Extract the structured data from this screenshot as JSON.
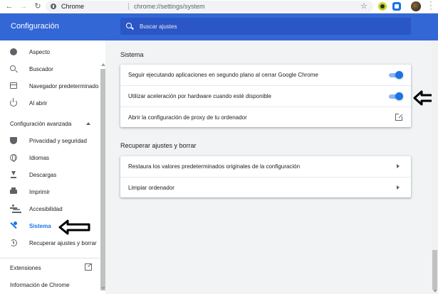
{
  "browser": {
    "omnibox": {
      "origin": "Chrome",
      "url": "chrome://settings/system"
    },
    "icons": [
      "back-icon",
      "forward-icon",
      "reload-icon",
      "site-info-icon",
      "star-icon",
      "extension-icon",
      "avatar",
      "menu-icon"
    ]
  },
  "header": {
    "title": "Configuración",
    "search_placeholder": "Buscar ajustes"
  },
  "sidebar": {
    "items": [
      {
        "label": "Aspecto",
        "icon": "palette-icon"
      },
      {
        "label": "Buscador",
        "icon": "search-icon"
      },
      {
        "label": "Navegador predeterminado",
        "icon": "browser-icon"
      },
      {
        "label": "Al abrir",
        "icon": "power-icon"
      }
    ],
    "advanced_label": "Configuración avanzada",
    "advanced_items": [
      {
        "label": "Privacidad y seguridad",
        "icon": "shield-icon"
      },
      {
        "label": "Idiomas",
        "icon": "globe-icon"
      },
      {
        "label": "Descargas",
        "icon": "download-icon"
      },
      {
        "label": "Imprimir",
        "icon": "print-icon"
      },
      {
        "label": "Accesibilidad",
        "icon": "accessibility-icon"
      },
      {
        "label": "Sistema",
        "icon": "wrench-icon",
        "active": true
      },
      {
        "label": "Recuperar ajustes y borrar",
        "icon": "restore-icon"
      }
    ],
    "extensions_label": "Extensiones",
    "about_label": "Información de Chrome"
  },
  "main": {
    "system": {
      "title": "Sistema",
      "rows": [
        {
          "label": "Seguir ejecutando aplicaciones en segundo plano al cerrar Google Chrome",
          "control": "toggle",
          "on": true
        },
        {
          "label": "Utilizar aceleración por hardware cuando esté disponible",
          "control": "toggle",
          "on": true
        },
        {
          "label": "Abrir la configuración de proxy de tu ordenador",
          "control": "open-link-icon"
        }
      ]
    },
    "reset": {
      "title": "Recuperar ajustes y borrar",
      "rows": [
        {
          "label": "Restaura los valores predeterminados originales de la configuración",
          "control": "chevron-right-icon"
        },
        {
          "label": "Limpiar ordenador",
          "control": "chevron-right-icon"
        }
      ]
    }
  },
  "colors": {
    "header_blue": "#3367d6",
    "search_blue": "#2a56c6",
    "accent": "#1a73e8",
    "toggle_track": "#8ab4f8",
    "page_bg": "#f1f3f4"
  }
}
